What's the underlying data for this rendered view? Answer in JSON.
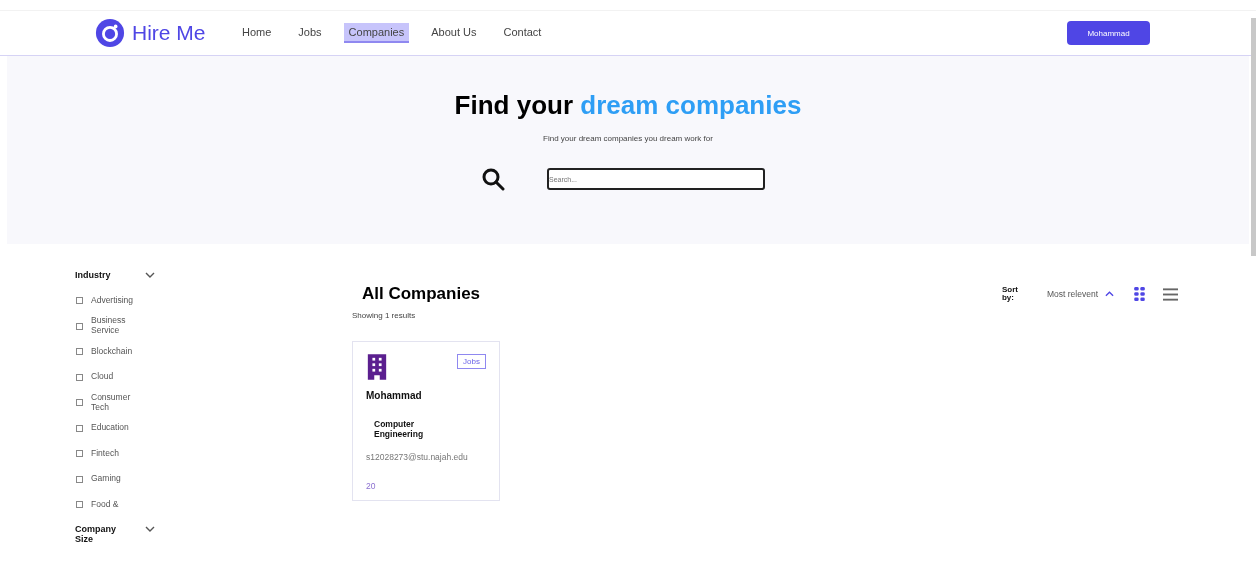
{
  "brand": "Hire Me",
  "nav": [
    {
      "label": "Home",
      "selected": false
    },
    {
      "label": "Jobs",
      "selected": false
    },
    {
      "label": "Companies",
      "selected": true
    },
    {
      "label": "About Us",
      "selected": false
    },
    {
      "label": "Contact",
      "selected": false
    }
  ],
  "user_button": "Mohammad",
  "hero": {
    "title_lead": "Find your",
    "title_highlight": "dream companies",
    "subtitle": "Find your dream companies you dream work for",
    "search": {
      "placeholder": "Search..."
    }
  },
  "filters": [
    {
      "title": "Industry",
      "expanded": true,
      "options": [
        {
          "label": "Advertising",
          "checked": false
        },
        {
          "label": "Business Service",
          "checked": false
        },
        {
          "label": "Blockchain",
          "checked": false
        },
        {
          "label": "Cloud",
          "checked": false
        },
        {
          "label": "Consumer Tech",
          "checked": false
        },
        {
          "label": "Education",
          "checked": false
        },
        {
          "label": "Fintech",
          "checked": false
        },
        {
          "label": "Gaming",
          "checked": false
        },
        {
          "label": "Food &",
          "checked": false
        }
      ]
    },
    {
      "title": "Company Size",
      "expanded": true
    }
  ],
  "results": {
    "title": "All Companies",
    "count": "Showing 1 results",
    "sort_label": "Sort by:",
    "sort_value": "Most relevent",
    "views": [
      {
        "kind": "grid",
        "selected": true
      },
      {
        "kind": "list",
        "selected": false
      }
    ]
  },
  "companies": [
    {
      "name": "Mohammad",
      "tag": "Jobs",
      "field": "Computer Engineering",
      "email": "s12028273@stu.najah.edu",
      "number": "20"
    }
  ]
}
